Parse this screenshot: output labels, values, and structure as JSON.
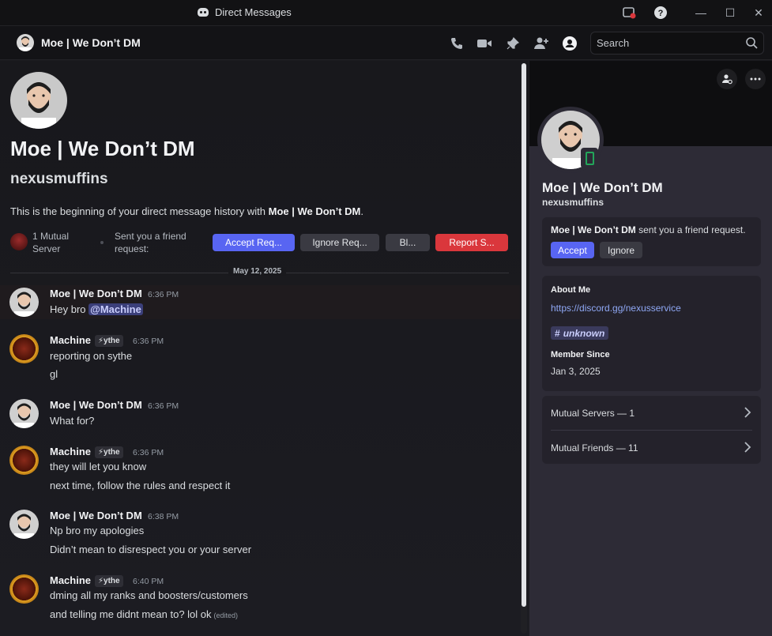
{
  "window": {
    "title": "Direct Messages",
    "controls": {
      "minimize": "—",
      "maximize": "☐",
      "close": "✕"
    }
  },
  "header": {
    "name": "Moe | We Don’t DM",
    "search_placeholder": "Search"
  },
  "intro": {
    "display_name": "Moe | We Don’t DM",
    "username": "nexusmuffins",
    "description_prefix": "This is the beginning of your direct message history with ",
    "description_name": "Moe | We Don’t DM",
    "description_suffix": ".",
    "mutual_servers": "1 Mutual Server",
    "friend_request_text": "Sent you a friend request:",
    "buttons": {
      "accept": "Accept Req...",
      "ignore": "Ignore Req...",
      "block": "Bl...",
      "report": "Report S..."
    }
  },
  "date_divider": "May 12, 2025",
  "messages": [
    {
      "author": "Moe | We Don’t DM",
      "time": "6:36 PM",
      "lines": [
        "Hey bro "
      ],
      "mention": "@Machine"
    },
    {
      "author": "Machine",
      "tag": "⚡ythe",
      "time": "6:36 PM",
      "lines": [
        "reporting on sythe",
        "gl"
      ]
    },
    {
      "author": "Moe | We Don’t DM",
      "time": "6:36 PM",
      "lines": [
        "What for?"
      ]
    },
    {
      "author": "Machine",
      "tag": "⚡ythe",
      "time": "6:36 PM",
      "lines": [
        "they will let you know",
        "next time, follow the rules and respect it"
      ]
    },
    {
      "author": "Moe | We Don’t DM",
      "time": "6:38 PM",
      "lines": [
        "Np bro my apologies",
        "Didn’t mean to disrespect you or your server"
      ]
    },
    {
      "author": "Machine",
      "tag": "⚡ythe",
      "time": "6:40 PM",
      "lines": [
        "dming all my ranks and boosters/customers",
        "and telling me didnt mean to? lol ok"
      ],
      "edited": "(edited)"
    }
  ],
  "profile": {
    "display_name": "Moe | We Don’t DM",
    "username": "nexusmuffins",
    "friend_request": {
      "name": "Moe | We Don’t DM",
      "text": " sent you a friend request.",
      "accept": "Accept",
      "ignore": "Ignore"
    },
    "about_me": {
      "heading": "About Me",
      "link": "https://discord.gg/nexusservice",
      "channel": "unknown"
    },
    "member_since": {
      "heading": "Member Since",
      "date": "Jan 3, 2025"
    },
    "mutual_servers": "Mutual Servers — 1",
    "mutual_friends": "Mutual Friends — 11"
  },
  "colors": {
    "accent": "#5865f2",
    "danger": "#da373c",
    "online_mobile": "#23a55a",
    "link": "#8fa8f5"
  }
}
